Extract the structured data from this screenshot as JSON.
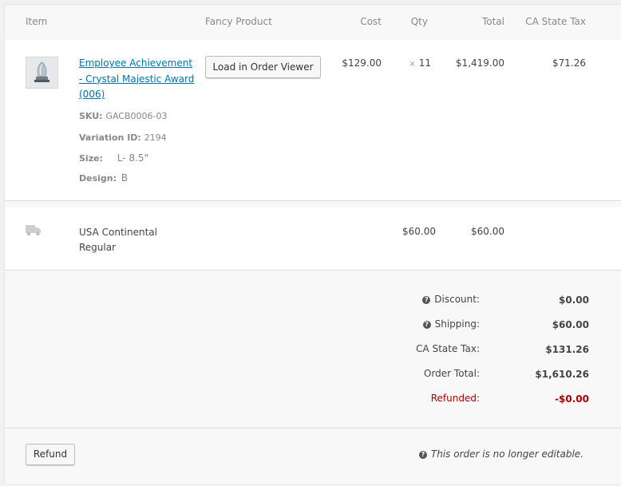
{
  "columns": {
    "item": "Item",
    "fancy_product": "Fancy Product",
    "cost": "Cost",
    "qty": "Qty",
    "total": "Total",
    "tax": "CA State Tax"
  },
  "line_item": {
    "name": "Employee Achievement - Crystal Majestic Award (006)",
    "sku_label": "SKU:",
    "sku": "GACB0006-03",
    "variation_label": "Variation ID:",
    "variation_id": "2194",
    "size_label": "Size:",
    "size": "L- 8.5\"",
    "design_label": "Design:",
    "design": "B",
    "load_button": "Load in Order Viewer",
    "cost": "$129.00",
    "qty_prefix": "×",
    "qty": "11",
    "total": "$1,419.00",
    "tax": "$71.26"
  },
  "shipping_line": {
    "icon": "truck-icon",
    "method": "USA Continental Regular",
    "cost": "$60.00",
    "total": "$60.00"
  },
  "totals": {
    "discount_label": "Discount:",
    "discount": "$0.00",
    "shipping_label": "Shipping:",
    "shipping": "$60.00",
    "tax_label": "CA State Tax:",
    "tax": "$131.26",
    "order_total_label": "Order Total:",
    "order_total": "$1,610.26",
    "refunded_label": "Refunded:",
    "refunded": "-$0.00",
    "refunded_color": "#aa0000"
  },
  "footer": {
    "refund_button": "Refund",
    "notice": "This order is no longer editable.",
    "help_icon": "question-circle-icon"
  }
}
